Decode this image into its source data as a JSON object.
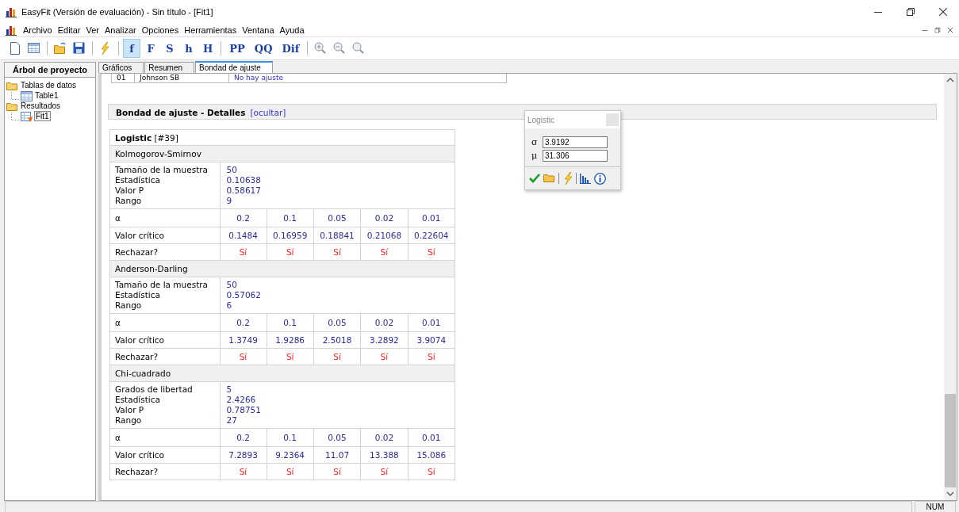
{
  "window": {
    "title": "EasyFit (Versión de evaluación) - Sin título - [Fit1]"
  },
  "menu": [
    "Archivo",
    "Editar",
    "Ver",
    "Analizar",
    "Opciones",
    "Herramientas",
    "Ventana",
    "Ayuda"
  ],
  "toolbar": {
    "text_groups": [
      [
        {
          "label": "f",
          "selected": true
        },
        {
          "label": "F",
          "selected": false
        },
        {
          "label": "S",
          "selected": false
        },
        {
          "label": "h",
          "selected": false
        },
        {
          "label": "H",
          "selected": false
        }
      ],
      [
        {
          "label": "PP",
          "selected": false
        },
        {
          "label": "QQ",
          "selected": false
        },
        {
          "label": "Dif",
          "selected": false
        }
      ]
    ]
  },
  "sidebar": {
    "title": "Árbol de proyecto",
    "tree": [
      {
        "label": "Tablas de datos",
        "children": [
          {
            "label": "Table1",
            "kind": "table",
            "selected": false
          }
        ]
      },
      {
        "label": "Resultados",
        "children": [
          {
            "label": "Fit1",
            "kind": "fit",
            "selected": true
          }
        ]
      }
    ]
  },
  "tabs": [
    {
      "label": "Gráficos",
      "selected": false
    },
    {
      "label": "Resumen",
      "selected": false
    },
    {
      "label": "Bondad de ajuste",
      "selected": true
    }
  ],
  "results_row": [
    "01",
    "Johnson SB",
    "No hay ajuste"
  ],
  "section": {
    "title": "Bondad de ajuste - Detalles",
    "link": "[ocultar]"
  },
  "fit": {
    "name": "Logistic",
    "index": "[#39]",
    "tests": [
      {
        "name": "Kolmogorov-Smirnov",
        "stats": [
          {
            "label": "Tamaño de la muestra",
            "value": "50"
          },
          {
            "label": "Estadística",
            "value": "0.10638"
          },
          {
            "label": "Valor P",
            "value": "0.58617"
          },
          {
            "label": "Rango",
            "value": "9"
          }
        ],
        "rows": [
          {
            "kind": "alpha",
            "label": "α",
            "values": [
              "0.2",
              "0.1",
              "0.05",
              "0.02",
              "0.01"
            ]
          },
          {
            "kind": "critical",
            "label": "Valor crítico",
            "values": [
              "0.1484",
              "0.16959",
              "0.18841",
              "0.21068",
              "0.22604"
            ]
          },
          {
            "kind": "reject",
            "label": "Rechazar?",
            "values": [
              "Sí",
              "Sí",
              "Sí",
              "Sí",
              "Sí"
            ]
          }
        ]
      },
      {
        "name": "Anderson-Darling",
        "stats": [
          {
            "label": "Tamaño de la muestra",
            "value": "50"
          },
          {
            "label": "Estadística",
            "value": "0.57062"
          },
          {
            "label": "Rango",
            "value": "6"
          }
        ],
        "rows": [
          {
            "kind": "alpha",
            "label": "α",
            "values": [
              "0.2",
              "0.1",
              "0.05",
              "0.02",
              "0.01"
            ]
          },
          {
            "kind": "critical",
            "label": "Valor crítico",
            "values": [
              "1.3749",
              "1.9286",
              "2.5018",
              "3.2892",
              "3.9074"
            ]
          },
          {
            "kind": "reject",
            "label": "Rechazar?",
            "values": [
              "Sí",
              "Sí",
              "Sí",
              "Sí",
              "Sí"
            ]
          }
        ]
      },
      {
        "name": "Chi-cuadrado",
        "stats": [
          {
            "label": "Grados de libertad",
            "value": "5"
          },
          {
            "label": "Estadística",
            "value": "2.4266"
          },
          {
            "label": "Valor P",
            "value": "0.78751"
          },
          {
            "label": "Rango",
            "value": "27"
          }
        ],
        "rows": [
          {
            "kind": "alpha",
            "label": "α",
            "values": [
              "0.2",
              "0.1",
              "0.05",
              "0.02",
              "0.01"
            ]
          },
          {
            "kind": "critical",
            "label": "Valor crítico",
            "values": [
              "7.2893",
              "9.2364",
              "11.07",
              "13.388",
              "15.086"
            ]
          },
          {
            "kind": "reject",
            "label": "Rechazar?",
            "values": [
              "Sí",
              "Sí",
              "Sí",
              "Sí",
              "Sí"
            ]
          }
        ]
      }
    ]
  },
  "dialog": {
    "title": "Logistic",
    "params": [
      {
        "symbol": "σ",
        "value": "3.9192"
      },
      {
        "symbol": "μ",
        "value": "31.306"
      }
    ]
  },
  "status_bar": {
    "indicator": "NUM"
  }
}
